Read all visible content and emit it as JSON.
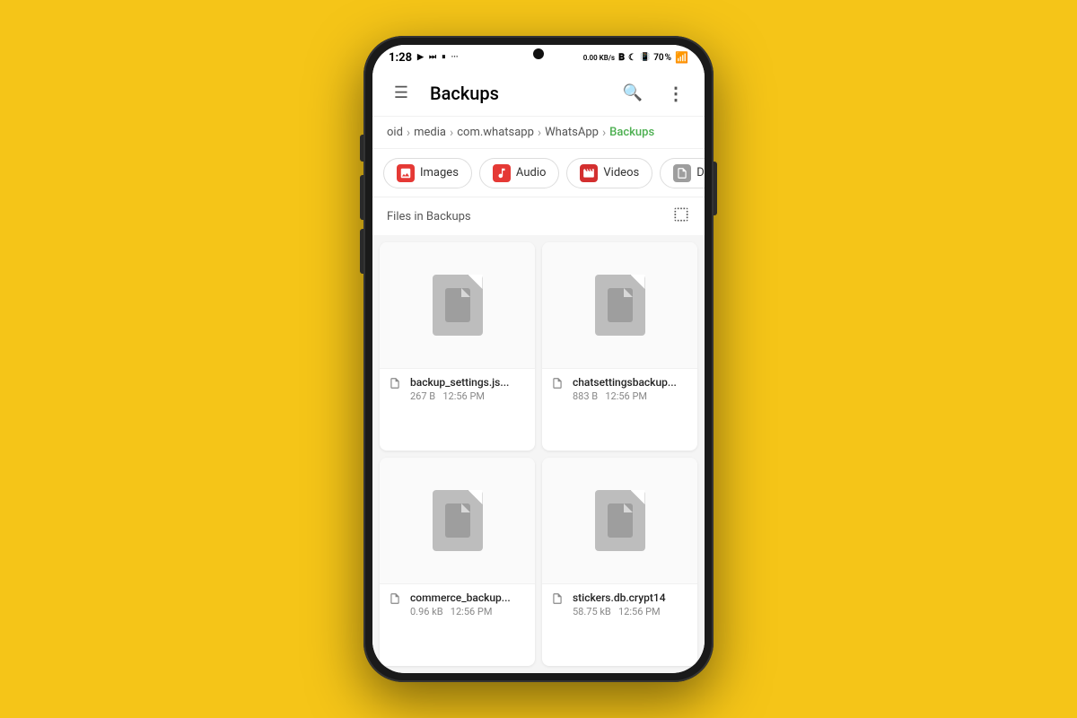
{
  "background_color": "#F5C518",
  "phone": {
    "status_bar": {
      "time": "1:28",
      "battery": "70",
      "network_speed": "0.00 KB/s"
    },
    "app_bar": {
      "title": "Backups",
      "menu_icon": "☰",
      "search_icon": "🔍",
      "more_icon": "⋮"
    },
    "breadcrumb": {
      "items": [
        {
          "label": "oid",
          "active": false
        },
        {
          "label": "media",
          "active": false
        },
        {
          "label": "com.whatsapp",
          "active": false
        },
        {
          "label": "WhatsApp",
          "active": false
        },
        {
          "label": "Backups",
          "active": true
        }
      ]
    },
    "filter_chips": [
      {
        "id": "images",
        "label": "Images",
        "icon_type": "images"
      },
      {
        "id": "audio",
        "label": "Audio",
        "icon_type": "audio"
      },
      {
        "id": "videos",
        "label": "Videos",
        "icon_type": "videos"
      },
      {
        "id": "documents",
        "label": "Documents",
        "icon_type": "docs"
      }
    ],
    "files_section": {
      "header": "Files in Backups",
      "files": [
        {
          "name": "backup_settings.js...",
          "size": "267 B",
          "time": "12:56 PM"
        },
        {
          "name": "chatsettingsbackup...",
          "size": "883 B",
          "time": "12:56 PM"
        },
        {
          "name": "commerce_backup...",
          "size": "0.96 kB",
          "time": "12:56 PM"
        },
        {
          "name": "stickers.db.crypt14",
          "size": "58.75 kB",
          "time": "12:56 PM"
        }
      ]
    }
  }
}
